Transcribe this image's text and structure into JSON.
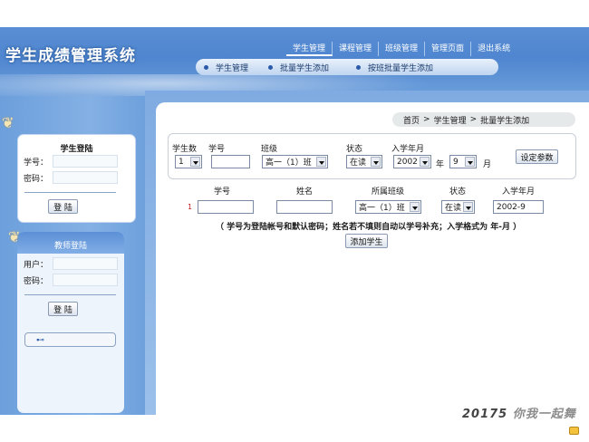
{
  "header": {
    "title": "学生成绩管理系统",
    "nav": [
      "学生管理",
      "课程管理",
      "班级管理",
      "管理页面",
      "退出系统"
    ],
    "subnav": [
      "学生管理",
      "批量学生添加",
      "按班批量学生添加"
    ]
  },
  "student_login": {
    "title": "学生登陆",
    "id_label": "学号：",
    "password_label": "密码：",
    "login_button": "登 陆"
  },
  "teacher_login": {
    "title": "教师登陆",
    "user_label": "用户：",
    "password_label": "密码：",
    "login_button": "登 陆"
  },
  "breadcrumb": [
    "首页",
    ">",
    "学生管理",
    ">",
    "批量学生添加"
  ],
  "params": {
    "count_label": "学生数",
    "count_value": "1",
    "id_label": "学号",
    "id_value": "",
    "class_label": "班级",
    "class_value": "高一（1）班",
    "status_label": "状态",
    "status_value": "在读",
    "enroll_label": "入学年月",
    "year_value": "2002",
    "year_unit": "年",
    "month_value": "9",
    "month_unit": "月",
    "set_button": "设定参数"
  },
  "table": {
    "headers": [
      "学号",
      "姓名",
      "所属班级",
      "状态",
      "入学年月"
    ],
    "rows": [
      {
        "num": "1",
        "id": "",
        "name": "",
        "class": "高一（1）班",
        "status": "在读",
        "enroll": "2002-9"
      }
    ]
  },
  "note": "（ 学号为登陆帐号和默认密码；姓名若不填则自动以学号补充；入学格式为 年-月 ）",
  "add_button": "添加学生",
  "footer": {
    "logo": "20175",
    "slogan": "你我一起舞"
  }
}
